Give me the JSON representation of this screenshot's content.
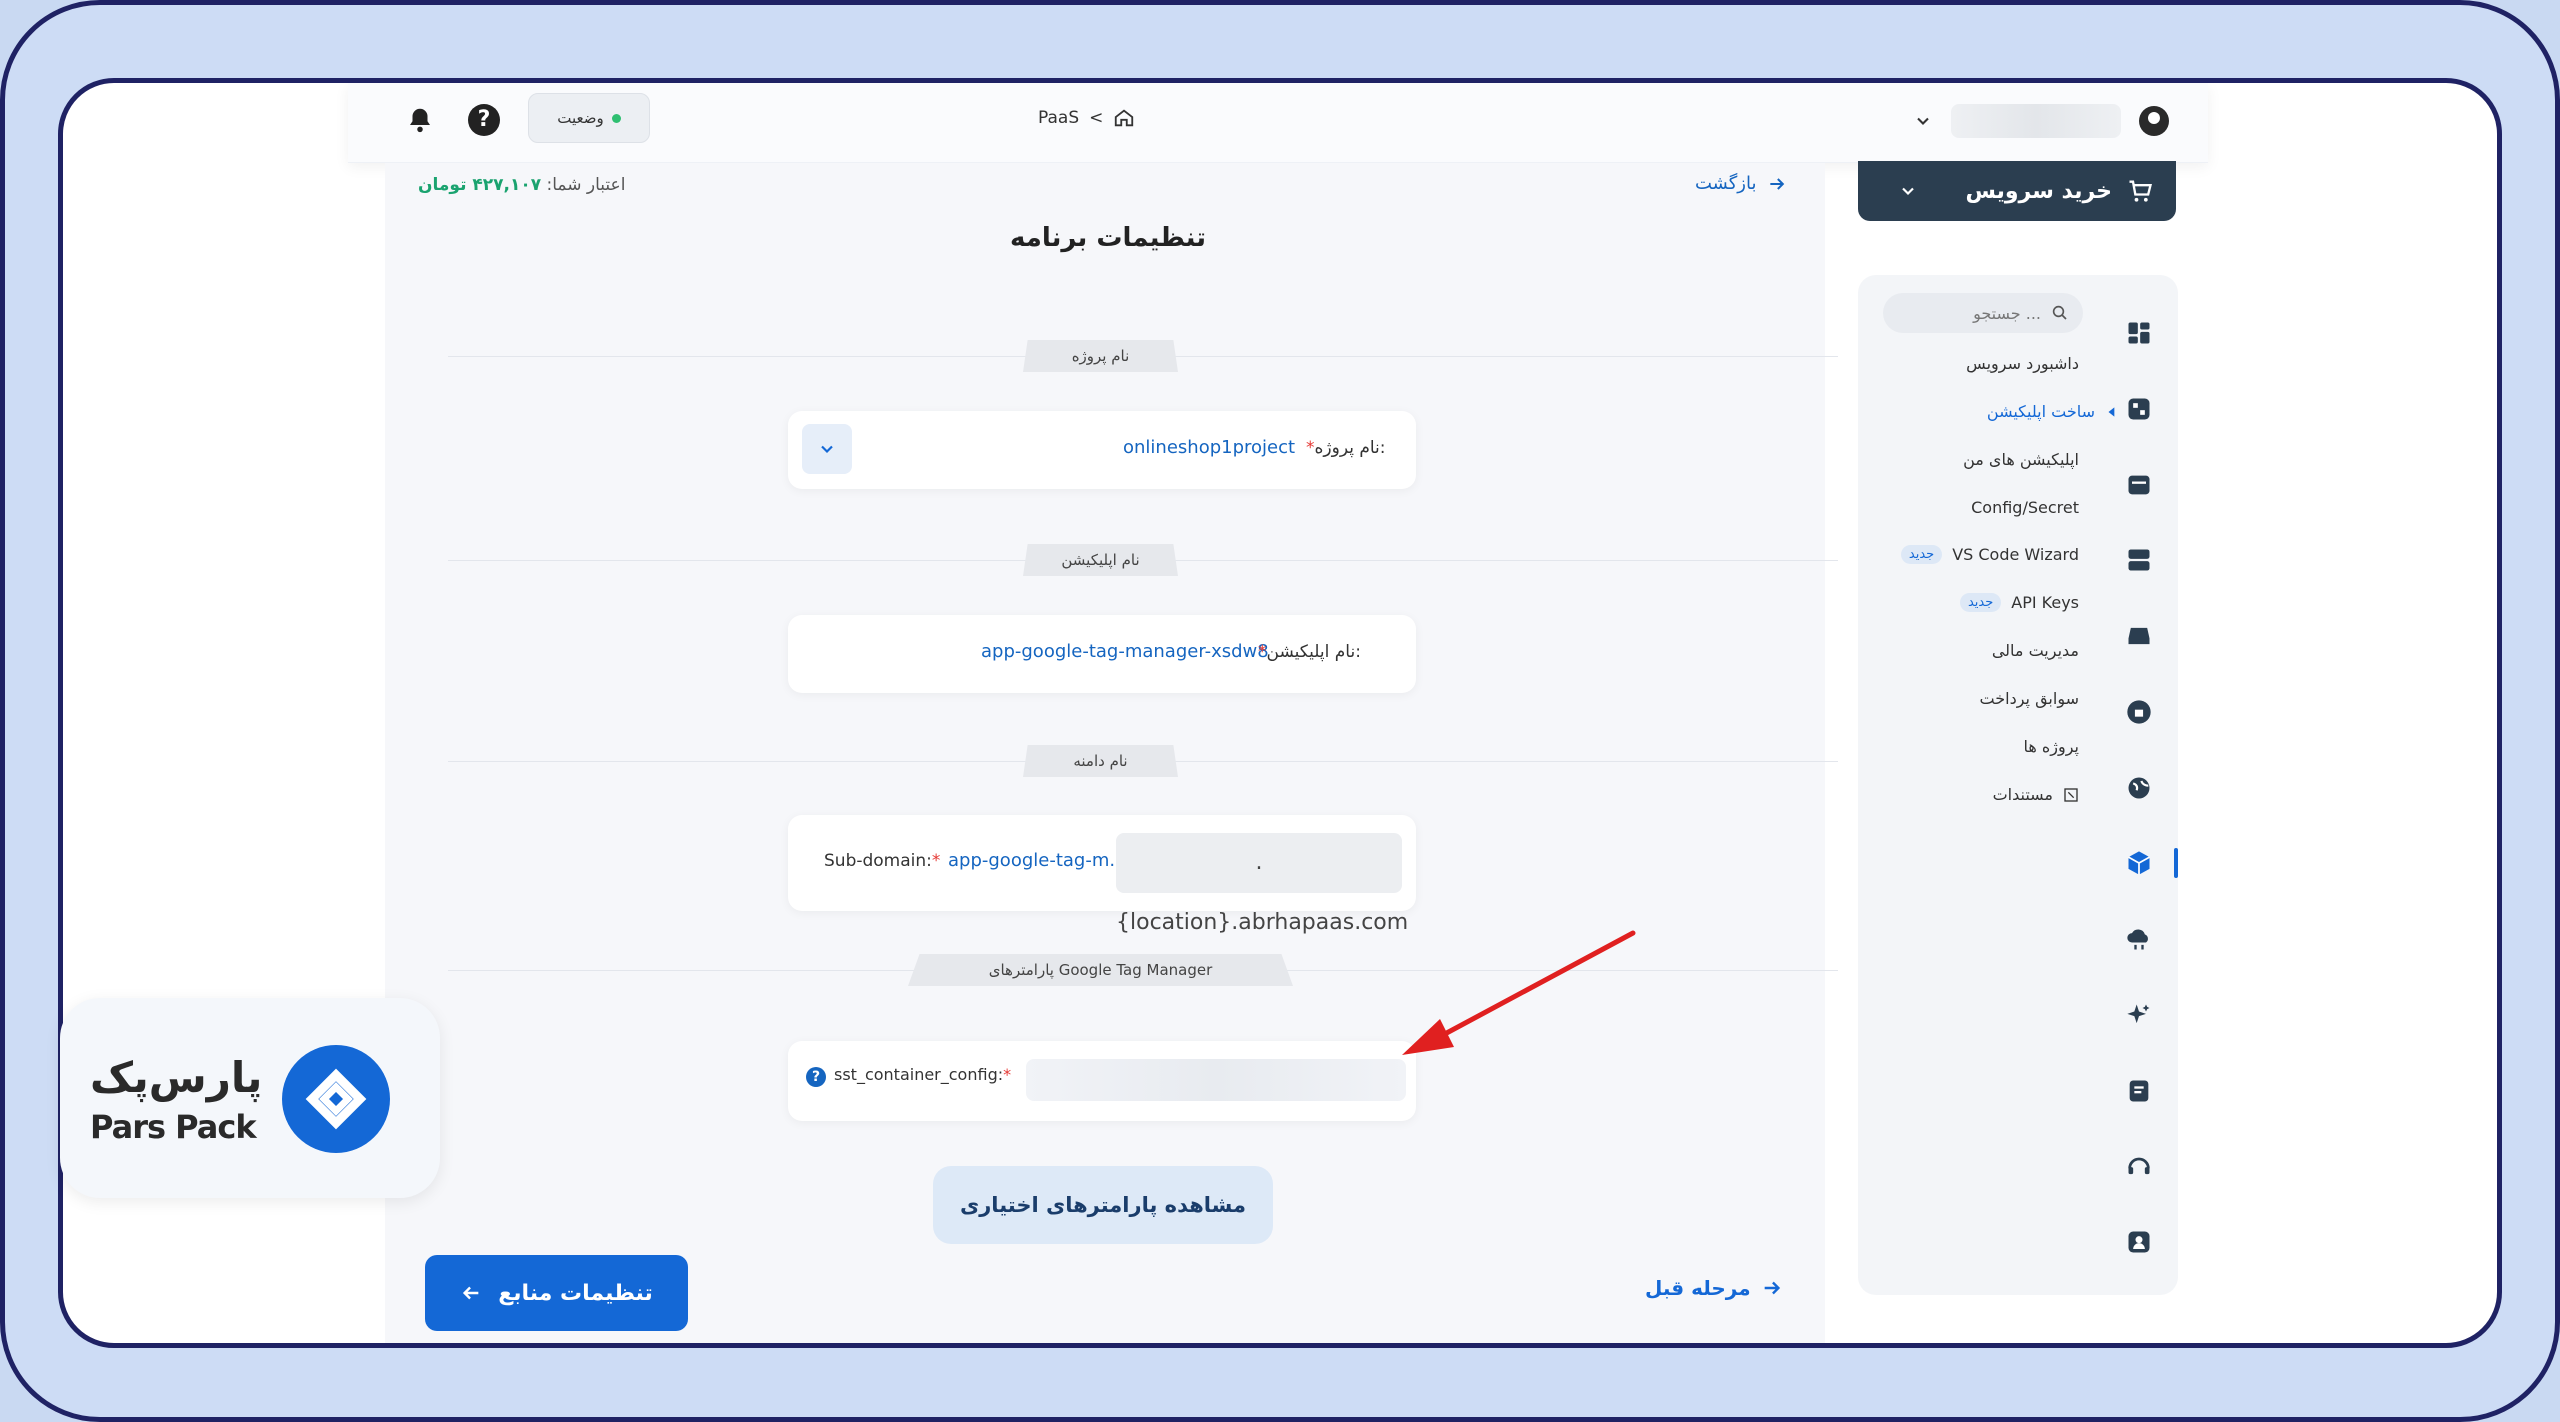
{
  "topbar": {
    "status_label": "وضعیت",
    "breadcrumb": "PaaS",
    "breadcrumb_sep": "<"
  },
  "header": {
    "back_label": "بازگشت",
    "credit_label": "اعتبار شما:",
    "credit_amount": "۴۲۷,۱۰۷ تومان",
    "page_title": "تنظیمات برنامه"
  },
  "sections": {
    "project": {
      "title": "نام پروژه",
      "field_label": "نام پروژه:",
      "value": "onlineshop1project"
    },
    "app": {
      "title": "نام اپلیکیشن",
      "field_label": "نام اپلیکیشن:",
      "value": "app-google-tag-manager-xsdw8"
    },
    "domain": {
      "title": "نام دامنه",
      "field_label": "Sub-domain:",
      "value": "app-google-tag-m...",
      "suffix": ".{location}.abrhapaas.com"
    },
    "gtm": {
      "title": "پارامترهای Google Tag Manager",
      "field_label": "sst_container_config:"
    }
  },
  "actions": {
    "optional_params": "مشاهده پارامترهای اختیاری",
    "next": "تنظیمات منابع",
    "prev": "مرحله قبل"
  },
  "sidebar": {
    "buy_label": "خرید سرویس",
    "search_placeholder": "جستجو ...",
    "new_badge": "جدید",
    "items": [
      {
        "label": "داشبورد سرویس"
      },
      {
        "label": "ساخت اپلیکیشن"
      },
      {
        "label": "اپلیکیشن های من"
      },
      {
        "label": "Config/Secret"
      },
      {
        "label": "VS Code Wizard"
      },
      {
        "label": "API Keys"
      },
      {
        "label": "مدیریت مالی"
      },
      {
        "label": "سوابق پرداخت"
      },
      {
        "label": "پروژه ها"
      },
      {
        "label": "مستندات"
      }
    ]
  },
  "logo": {
    "fa": "پارس‌پک",
    "en": "Pars Pack"
  },
  "colors": {
    "primary": "#1468d6",
    "frame": "#1f2264",
    "success": "#1aa36f",
    "annotation_arrow": "#e02020"
  }
}
